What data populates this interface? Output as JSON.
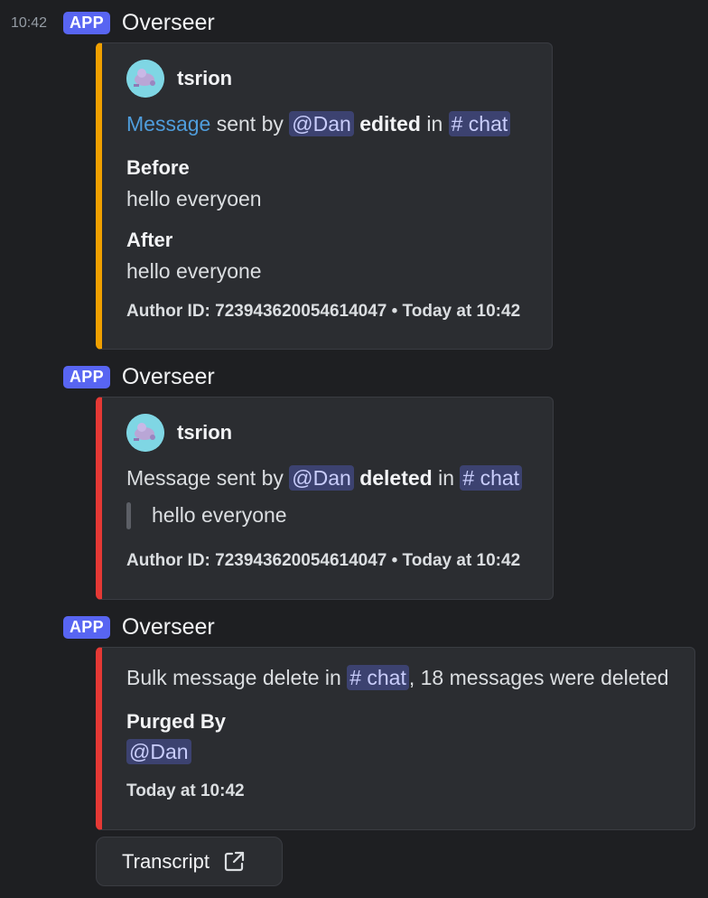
{
  "message_group": {
    "timestamp": "10:42",
    "badge": "APP",
    "author": "Overseer"
  },
  "embed_edit": {
    "author": "tsrion",
    "link_text": "Message",
    "sent_by": " sent by ",
    "mention": "@Dan",
    "action": "edited",
    "in_text": " in ",
    "channel": "# chat",
    "field_before_name": "Before",
    "field_before_value": "hello everyoen",
    "field_after_name": "After",
    "field_after_value": "hello everyone",
    "footer": "Author ID: 723943620054614047 • Today at 10:42",
    "accent_color": "#f0a000"
  },
  "embed_delete": {
    "badge": "APP",
    "author_line": "Overseer",
    "author": "tsrion",
    "prefix": "Message sent by ",
    "mention": "@Dan",
    "action": "deleted",
    "in_text": " in ",
    "channel": "# chat",
    "quote": "hello everyone",
    "footer": "Author ID: 723943620054614047 • Today at 10:42",
    "accent_color": "#e53935"
  },
  "embed_bulk": {
    "badge": "APP",
    "author_line": "Overseer",
    "prefix": "Bulk message delete in ",
    "channel": "# chat",
    "suffix": ", 18 messages were deleted",
    "field_name": "Purged By",
    "field_value": "@Dan",
    "footer": "Today at 10:42",
    "accent_color": "#e53935"
  },
  "transcript_button": {
    "label": "Transcript",
    "icon": "external-link-icon"
  },
  "colors": {
    "background": "#1e1f22",
    "embed_bg": "#2b2d31",
    "badge": "#5865f2",
    "mention_bg": "#3c4270",
    "link": "#4f9ddc"
  }
}
